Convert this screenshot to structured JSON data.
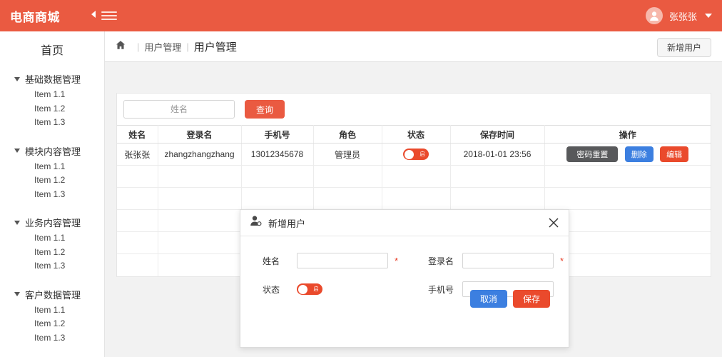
{
  "header": {
    "brand": "电商商城",
    "menu_toggle_icon": "hamburger-collapse-icon",
    "avatar_icon": "user-avatar-icon",
    "user_name": "张张张",
    "caret_icon": "chevron-down-icon"
  },
  "sidebar": {
    "home_label": "首页",
    "groups": [
      {
        "label": "基础数据管理",
        "items": [
          "Item 1.1",
          "Item 1.2",
          "Item 1.3"
        ]
      },
      {
        "label": "模块内容管理",
        "items": [
          "Item 1.1",
          "Item 1.2",
          "Item 1.3"
        ]
      },
      {
        "label": "业务内容管理",
        "items": [
          "Item 1.1",
          "Item 1.2",
          "Item 1.3"
        ]
      },
      {
        "label": "客户数据管理",
        "items": [
          "Item 1.1",
          "Item 1.2",
          "Item 1.3"
        ]
      }
    ]
  },
  "breadcrumb": {
    "home_icon": "home-icon",
    "separator": "|",
    "parent": "用户管理",
    "current": "用户管理",
    "add_user_label": "新增用户"
  },
  "toolbar": {
    "search_placeholder": "姓名",
    "search_value": "",
    "query_label": "查询"
  },
  "table": {
    "columns": [
      "姓名",
      "登录名",
      "手机号",
      "角色",
      "状态",
      "保存时间",
      "操作"
    ],
    "rows": [
      {
        "name": "张张张",
        "login": "zhangzhangzhang",
        "phone": "13012345678",
        "role": "管理员",
        "status_label": "启",
        "status_on": true,
        "saved_at": "2018-01-01 23:56",
        "actions": [
          "密码重置",
          "删除",
          "编辑"
        ]
      }
    ],
    "empty_row_count": 5
  },
  "modal": {
    "icon": "user-add-icon",
    "title": "新增用户",
    "close_icon": "close-icon",
    "fields": {
      "name_label": "姓名",
      "name_value": "",
      "name_required": "*",
      "login_label": "登录名",
      "login_value": "",
      "login_required": "*",
      "status_label": "状态",
      "status_toggle_label": "启",
      "phone_label": "手机号",
      "phone_value": ""
    },
    "cancel_label": "取消",
    "save_label": "保存"
  },
  "colors": {
    "brand_orange": "#ea5a41",
    "accent_red": "#ea4a2c",
    "action_blue": "#3c7fe0",
    "action_gray": "#58595b",
    "page_bg": "#f2f2f2"
  }
}
